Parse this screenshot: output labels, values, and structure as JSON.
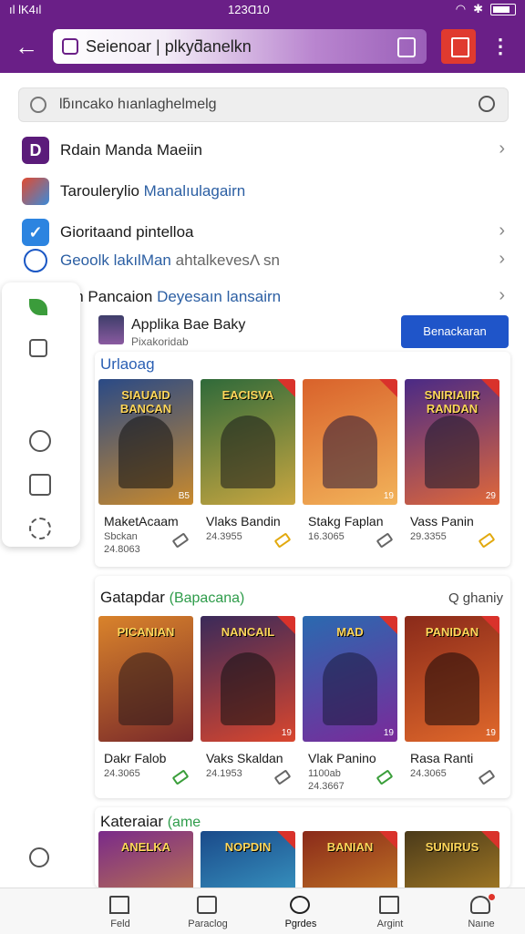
{
  "status_bar": {
    "left": "ıl lK4ıl",
    "time": "123Ɑ10"
  },
  "url_bar": {
    "text": "Seienoar | plkyƌanelkn"
  },
  "search": {
    "placeholder": "lƃıncako hıanlaghelmelg"
  },
  "list_items": [
    {
      "icon": "D",
      "icon_color": "#5b1b7a",
      "label": "Rdain Manda Maeiin",
      "chevron": true
    },
    {
      "icon": "",
      "icon_color": "#d9462e",
      "label": "Taroulerylio",
      "sublabel": "Manalıulagairn",
      "chevron": false
    },
    {
      "icon": "",
      "icon_color": "#2c84e0",
      "label": "Gioritaand pintelloa",
      "chevron": true
    },
    {
      "icon": "",
      "icon_color": "#1a57c4",
      "label": "Geoolk lakılMan",
      "sublabel": "ahtalkevesΛ sn",
      "chevron": true
    },
    {
      "label": "Adan Pancaion",
      "sublabel": "Deyesaın lansairn",
      "chevron": true
    }
  ],
  "pinned_app": {
    "title": "Applika Bae Baky",
    "subtitle": "Pixakoridab",
    "button": "Benackaran"
  },
  "sections": [
    {
      "title": "Urlaoag",
      "link": "",
      "cards": [
        {
          "art_title": "SIAUAID BANCAN",
          "name": "MaketAcaam",
          "meta1": "Sbckan",
          "meta2": "24.8063",
          "age": "B5",
          "tag": "grey",
          "colors": [
            "#2a4a86",
            "#c98a2d"
          ]
        },
        {
          "art_title": "EACISVA",
          "name": "Vlaks Bandin",
          "meta1": "",
          "meta2": "24.3955",
          "age": "",
          "tag": "yellow",
          "colors": [
            "#2f6a3a",
            "#c9a640"
          ]
        },
        {
          "art_title": "",
          "name": "Stakg Faplan",
          "meta1": "",
          "meta2": "16.3065",
          "age": "19",
          "tag": "grey",
          "colors": [
            "#d9622b",
            "#f2b35a"
          ]
        },
        {
          "art_title": "SNIRIAIIR RANDAN",
          "name": "Vass Panin",
          "meta1": "",
          "meta2": "29.3355",
          "age": "29",
          "tag": "yellow",
          "colors": [
            "#4a2a86",
            "#e0683a"
          ]
        }
      ]
    },
    {
      "title": "Gatapdar",
      "title_alt": "(Bapacana)",
      "link": "Q ghaniy",
      "cards": [
        {
          "art_title": "PICANIAN",
          "name": "Dakr Falob",
          "meta1": "",
          "meta2": "24.3065",
          "age": "",
          "tag": "green",
          "colors": [
            "#d9832b",
            "#7a2a2a"
          ]
        },
        {
          "art_title": "NANCAIL",
          "name": "Vaks Skaldan",
          "meta1": "",
          "meta2": "24.1953",
          "age": "19",
          "tag": "grey",
          "colors": [
            "#3a2a5a",
            "#d9462e"
          ]
        },
        {
          "art_title": "MAD",
          "name": "Vlak Panino",
          "meta1": "1100ab",
          "meta2": "24.3667",
          "age": "19",
          "tag": "green",
          "colors": [
            "#2a6ab0",
            "#7a2a9a"
          ]
        },
        {
          "art_title": "PANIDAN",
          "name": "Rasa Ranti",
          "meta1": "",
          "meta2": "24.3065",
          "age": "19",
          "tag": "grey",
          "colors": [
            "#8a2a1a",
            "#e0682b"
          ]
        }
      ]
    },
    {
      "title": "Kateraiar",
      "title_alt": "(ame",
      "link": "",
      "cards": [
        {
          "art_title": "ANELKA",
          "colors": [
            "#7a2a8a",
            "#e0a02b"
          ]
        },
        {
          "art_title": "NOPDIN",
          "colors": [
            "#1a4a8a",
            "#4ac0e0"
          ]
        },
        {
          "art_title": "BANIAN",
          "colors": [
            "#8a2a1a",
            "#e0a02b"
          ]
        },
        {
          "art_title": "SUNIRUS",
          "colors": [
            "#4a3a1a",
            "#d9a02b"
          ]
        }
      ]
    }
  ],
  "bottom_nav": [
    {
      "label": "Feld",
      "icon": "home-icon"
    },
    {
      "label": "Paraclog",
      "icon": "image-icon"
    },
    {
      "label": "Pgrdes",
      "icon": "account-icon"
    },
    {
      "label": "Argint",
      "icon": "monitor-icon"
    },
    {
      "label": "Naıne",
      "icon": "profile-icon",
      "badge": true
    }
  ]
}
